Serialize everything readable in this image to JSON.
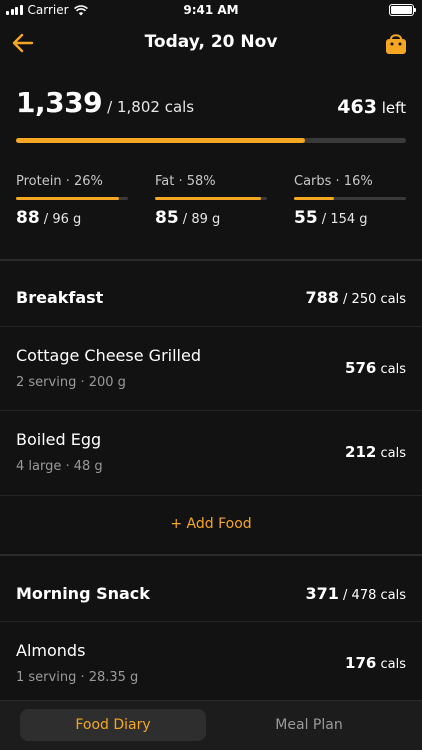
{
  "status_bar": {
    "carrier": "Carrier",
    "time": "9:41 AM"
  },
  "header": {
    "title": "Today, 20 Nov"
  },
  "summary": {
    "consumed": "1,339",
    "goal": "/ 1,802 cals",
    "remaining": "463",
    "remaining_label": " left",
    "progress": 0.74
  },
  "macros": [
    {
      "label": "Protein  ·  26%",
      "amount": "88",
      "target": " / 96 g",
      "progress": 0.92
    },
    {
      "label": "Fat  ·  58%",
      "amount": "85",
      "target": " / 89 g",
      "progress": 0.95
    },
    {
      "label": "Carbs  ·  16%",
      "amount": "55",
      "target": " / 154 g",
      "progress": 0.36
    }
  ],
  "meals": [
    {
      "name": "Breakfast",
      "cals": "788",
      "target": " / 250 cals",
      "items": [
        {
          "name": "Cottage Cheese Grilled",
          "detail": "2 serving  ·  200 g",
          "cals": "576",
          "unit": " cals"
        },
        {
          "name": "Boiled Egg",
          "detail": "4 large  ·  48 g",
          "cals": "212",
          "unit": " cals"
        }
      ],
      "add_label": "+ Add Food"
    },
    {
      "name": "Morning Snack",
      "cals": "371",
      "target": " / 478 cals",
      "items": [
        {
          "name": "Almonds",
          "detail": "1 serving  ·  28.35 g",
          "cals": "176",
          "unit": " cals"
        }
      ]
    }
  ],
  "tabs": {
    "active": "Food Diary",
    "inactive": "Meal Plan"
  },
  "colors": {
    "accent": "#f5a623",
    "background": "#121212"
  }
}
